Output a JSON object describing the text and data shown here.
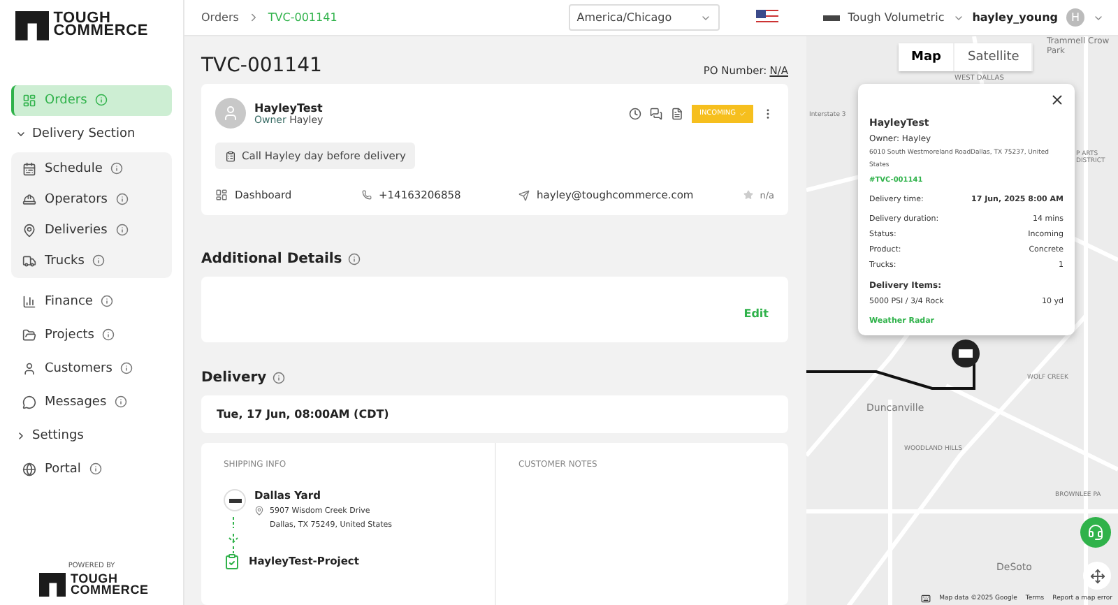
{
  "brand": {
    "logo_lines": [
      "TOUGH",
      "COMMERCE"
    ],
    "powered_by": "POWERED BY",
    "footer_logo_lines": [
      "TOUGH",
      "COMMERCE"
    ]
  },
  "sidebar": {
    "items": [
      {
        "label": "Orders",
        "selected": true,
        "info": true
      },
      {
        "label": "Delivery Section",
        "kind": "section",
        "expanded": true,
        "children": [
          {
            "label": "Schedule",
            "selected": false,
            "info": true
          },
          {
            "label": "Operators",
            "selected": false,
            "info": true
          },
          {
            "label": "Deliveries",
            "selected": false,
            "info": true
          },
          {
            "label": "Trucks",
            "selected": false,
            "info": true
          }
        ]
      },
      {
        "label": "Finance",
        "selected": false,
        "info": true
      },
      {
        "label": "Projects",
        "selected": false,
        "info": true
      },
      {
        "label": "Customers",
        "selected": false,
        "info": true
      },
      {
        "label": "Messages",
        "selected": false,
        "info": true
      },
      {
        "label": "Settings",
        "kind": "section",
        "expanded": false
      },
      {
        "label": "Portal",
        "selected": false,
        "info": true
      }
    ]
  },
  "breadcrumb": [
    {
      "label": "Orders",
      "selected": false
    },
    {
      "label": "TVC-001141",
      "selected": true
    }
  ],
  "header": {
    "timezone": "America/Chicago",
    "company": "Tough Volumetric",
    "username": "hayley_young",
    "avatar_initial": "H"
  },
  "order": {
    "title": "TVC-001141",
    "po_label": "PO Number:",
    "po_value": "N/A",
    "customer": {
      "name": "HayleyTest",
      "owner_label": "Owner",
      "owner": "Hayley",
      "status": "INCOMING",
      "note": "Call Hayley day before delivery",
      "project": "Dashboard",
      "phone": "+14163206858",
      "email": "hayley@toughcommerce.com",
      "rating": "n/a"
    }
  },
  "additional_details": {
    "title": "Additional Details",
    "edit": "Edit"
  },
  "delivery": {
    "title": "Delivery",
    "datetime": "Tue, 17 Jun, 08:00AM (CDT)",
    "shipping_heading": "SHIPPING INFO",
    "notes_heading": "CUSTOMER NOTES",
    "origin": {
      "name": "Dallas Yard",
      "address_lines": [
        "5907 Wisdom Creek Drive",
        "Dallas, TX 75249, United States"
      ]
    },
    "destination": {
      "name": "HayleyTest-Project"
    }
  },
  "map": {
    "tabs": [
      {
        "label": "Map",
        "selected": true
      },
      {
        "label": "Satellite",
        "selected": false
      }
    ],
    "labels": [
      "Trammell Crow Park",
      "WEST DALLAS",
      "Interstate 3",
      "P ARTS DISTRICT",
      "WOLF CREEK",
      "Duncanville",
      "WOODLAND HILLS",
      "BROWNLEE PA",
      "DeSoto"
    ],
    "footer": [
      "Map data ©2025 Google",
      "Terms",
      "Report a map error"
    ],
    "popup": {
      "name": "HayleyTest",
      "owner": "Owner: Hayley",
      "address": "6010 South Westmoreland RoadDallas, TX 75237, United States",
      "order_ref": "#TVC-001141",
      "rows": [
        {
          "label": "Delivery time:",
          "value": "17 Jun, 2025 8:00 AM"
        },
        {
          "label": "Delivery duration:",
          "value": "14 mins"
        },
        {
          "label": "Status:",
          "value": "Incoming"
        },
        {
          "label": "Product:",
          "value": "Concrete"
        },
        {
          "label": "Trucks:",
          "value": "1"
        }
      ],
      "items_heading": "Delivery Items:",
      "items": [
        {
          "name": "5000 PSI / 3/4 Rock",
          "qty": "10 yd"
        }
      ],
      "link": "Weather Radar"
    }
  }
}
